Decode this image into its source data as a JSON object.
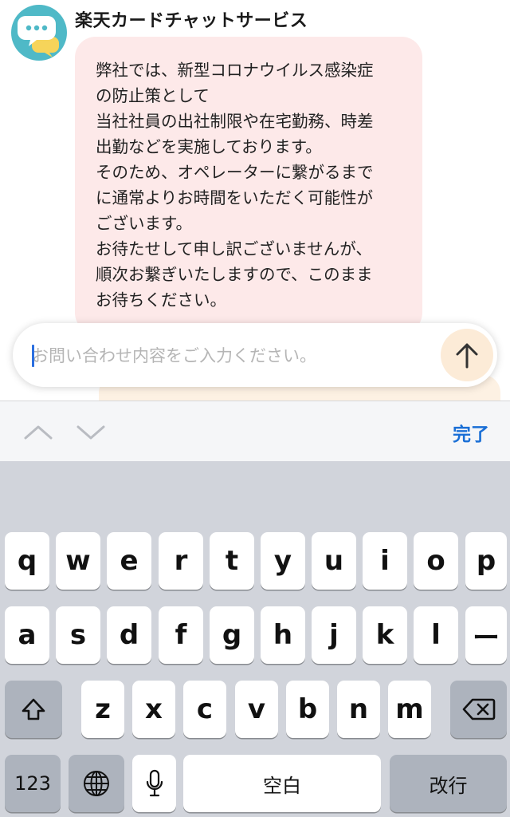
{
  "chat": {
    "sender_name": "楽天カードチャットサービス",
    "avatar_icon": "chat-bubbles-icon",
    "message_lines": [
      "弊社では、新型コロナウイルス感染症",
      "の防止策として",
      "当社社員の出社制限や在宅勤務、時差",
      "出勤などを実施しております。",
      "そのため、オペレーターに繋がるまで",
      "に通常よりお時間をいただく可能性が",
      "ございます。",
      "お待たせして申し訳ございませんが、",
      "順次お繋ぎいたしますので、このまま",
      "お待ちください。"
    ],
    "colors": {
      "bot_bubble": "#fde9e9",
      "user_bubble": "#fdf1e3",
      "avatar": "#4fb9c7"
    }
  },
  "input": {
    "placeholder": "お問い合わせ内容をご入力ください。",
    "value": "",
    "send_icon": "arrow-up-icon"
  },
  "toolbar": {
    "prev_icon": "chevron-up-icon",
    "next_icon": "chevron-down-icon",
    "done_label": "完了",
    "accent": "#1a6fd6"
  },
  "keyboard": {
    "row1": [
      "q",
      "w",
      "e",
      "r",
      "t",
      "y",
      "u",
      "i",
      "o",
      "p"
    ],
    "row2": [
      "a",
      "s",
      "d",
      "f",
      "g",
      "h",
      "j",
      "k",
      "l",
      "ー"
    ],
    "row3": [
      "z",
      "x",
      "c",
      "v",
      "b",
      "n",
      "m"
    ],
    "shift_icon": "shift-icon",
    "backspace_icon": "backspace-icon",
    "numbers_label": "123",
    "globe_icon": "globe-icon",
    "mic_icon": "microphone-icon",
    "space_label": "空白",
    "return_label": "改行"
  }
}
